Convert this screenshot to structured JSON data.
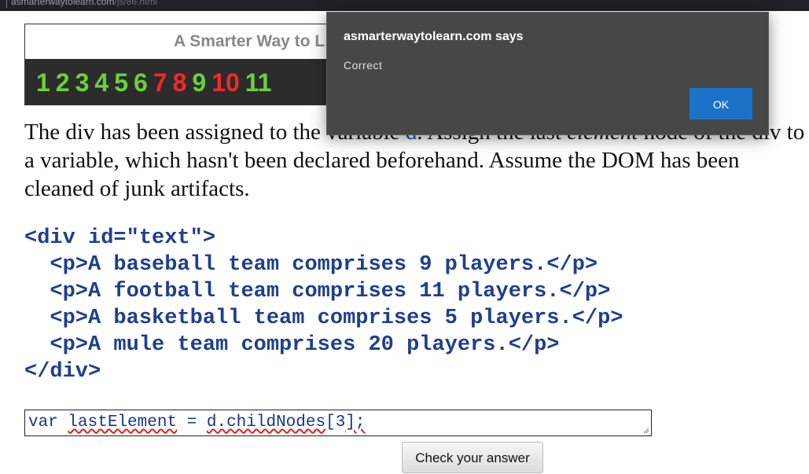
{
  "browser": {
    "url_visible": "asmarterwaytolearn.com",
    "url_tail": "/js/86.html"
  },
  "banner": {
    "brand": "A Smarter Way to L",
    "numbers": [
      {
        "text": "1",
        "color": "#6bd13a"
      },
      {
        "text": "2",
        "color": "#6bd13a"
      },
      {
        "text": "3",
        "color": "#6bd13a"
      },
      {
        "text": "4",
        "color": "#6bd13a"
      },
      {
        "text": "5",
        "color": "#6bd13a"
      },
      {
        "text": "6",
        "color": "#6bd13a"
      },
      {
        "text": "7",
        "color": "#f02a2a"
      },
      {
        "text": "8",
        "color": "#f02a2a"
      },
      {
        "text": "9",
        "color": "#6bd13a"
      },
      {
        "text": "10",
        "color": "#f02a2a"
      },
      {
        "text": "11",
        "color": "#6bd13a"
      }
    ]
  },
  "prompt": {
    "line1_a": "The div has been assigned to the variable ",
    "line1_var": "d",
    "line1_b": ". Assign the last ",
    "line1_em": "element",
    "line1_c": " node of the div to",
    "line2": "a variable, which hasn't been declared beforehand. Assume the DOM has been",
    "line3": "cleaned of junk artifacts."
  },
  "code": {
    "lines": [
      "<div id=\"text\">",
      "  <p>A baseball team comprises 9 players.</p>",
      "  <p>A football team comprises 11 players.</p>",
      "  <p>A basketball team comprises 5 players.</p>",
      "  <p>A mule team comprises 20 players.</p>",
      "</div>"
    ]
  },
  "answer": {
    "part1": "var ",
    "part2": "lastElement",
    "part3": " = ",
    "part4": "d.childNodes",
    "part5": "[3",
    "part6": "];"
  },
  "check_button": {
    "label": "Check your answer"
  },
  "dialog": {
    "title": "asmarterwaytolearn.com says",
    "message": "Correct",
    "ok_label": "OK"
  },
  "colors": {
    "dialog_bg": "#474747",
    "ok_button": "#1a73c8",
    "code_text": "#1e3f8f"
  }
}
